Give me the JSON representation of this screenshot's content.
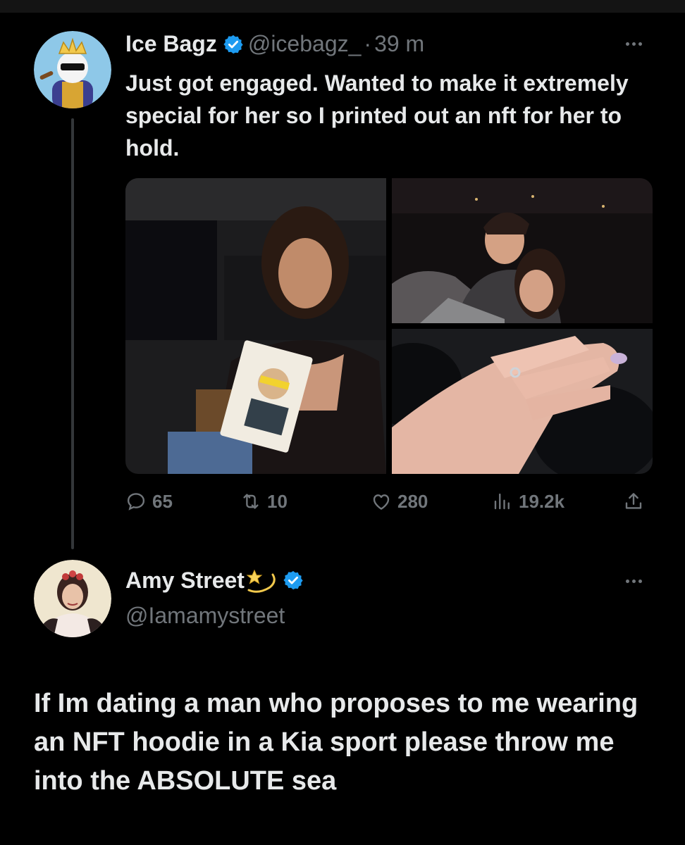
{
  "tweet1": {
    "name": "Ice Bagz",
    "handle": "@icebagz_",
    "separator": "·",
    "time": "39 m",
    "text": "Just got engaged. Wanted to make it extremely special for her so I printed out an nft for her to hold.",
    "media": [
      {
        "icon": "photo-woman-holding-nft-print"
      },
      {
        "icon": "photo-couple-selfie-night"
      },
      {
        "icon": "photo-hand-with-ring"
      }
    ],
    "actions": {
      "replies": "65",
      "retweets": "10",
      "likes": "280",
      "views": "19.2k"
    }
  },
  "tweet2": {
    "name": "Amy Street",
    "handle": "@Iamamystreet",
    "text": "If Im dating a man who proposes to me wearing an NFT hoodie in a Kia sport please throw me into the ABSOLUTE sea"
  },
  "colors": {
    "background": "#000000",
    "text_primary": "#e7e9ea",
    "text_secondary": "#71767b",
    "verified_blue": "#1d9bf0",
    "thread_line": "#333639"
  }
}
